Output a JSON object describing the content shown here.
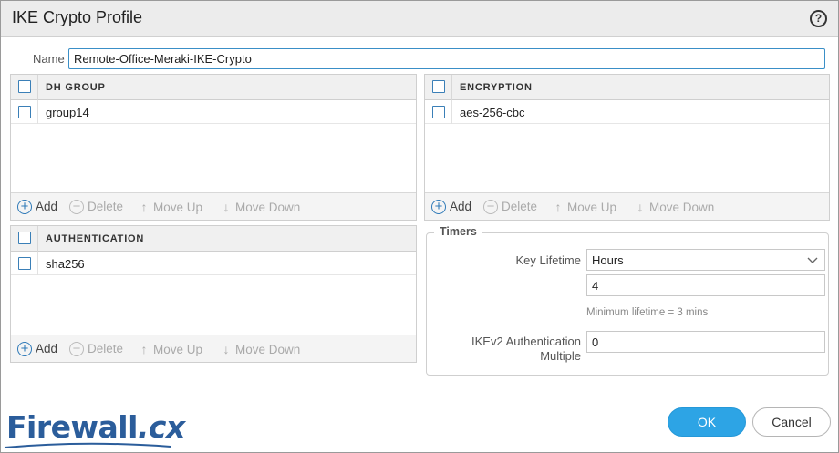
{
  "dialog": {
    "title": "IKE Crypto Profile",
    "help_icon": "help-icon",
    "help_glyph": "?"
  },
  "name_field": {
    "label": "Name",
    "value": "Remote-Office-Meraki-IKE-Crypto"
  },
  "dh_group": {
    "header": "DH GROUP",
    "rows": [
      "group14"
    ]
  },
  "encryption": {
    "header": "ENCRYPTION",
    "rows": [
      "aes-256-cbc"
    ]
  },
  "authentication": {
    "header": "AUTHENTICATION",
    "rows": [
      "sha256"
    ]
  },
  "toolbar": {
    "add": "Add",
    "delete": "Delete",
    "move_up": "Move Up",
    "move_down": "Move Down",
    "add_glyph": "+",
    "delete_glyph": "−",
    "up_glyph": "↑",
    "down_glyph": "↓"
  },
  "timers": {
    "legend": "Timers",
    "key_lifetime_label": "Key Lifetime",
    "key_lifetime_unit": "Hours",
    "key_lifetime_value": "4",
    "hint": "Minimum lifetime = 3 mins",
    "ikev2_label_line1": "IKEv2 Authentication",
    "ikev2_label_line2": "Multiple",
    "ikev2_value": "0"
  },
  "buttons": {
    "ok": "OK",
    "cancel": "Cancel"
  },
  "logo": {
    "text": "Firewall",
    "suffix": ".cx"
  },
  "colors": {
    "accent": "#2da4e5",
    "checkbox_border": "#3a7fb7",
    "logo": "#2b5d9b",
    "input_focus": "#3a8fc7"
  }
}
